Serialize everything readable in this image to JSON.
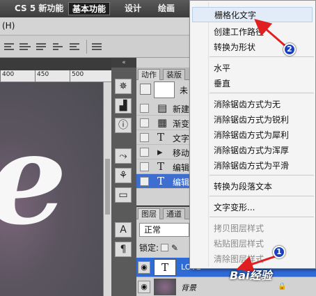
{
  "workspace": {
    "items": [
      "CS 5 新功能",
      "基本功能",
      "设计",
      "绘画"
    ],
    "active_index": 1
  },
  "menubar": {
    "partial_item": "(H)"
  },
  "ruler": {
    "labels": [
      "400",
      "450",
      "500"
    ]
  },
  "canvas": {
    "text": "e"
  },
  "panels": {
    "actions_tabs": [
      "动作",
      "装版"
    ],
    "snapshot_label": "未",
    "actions": [
      {
        "glyph": "▤",
        "label": "新建"
      },
      {
        "glyph": "▦",
        "label": "渐变"
      },
      {
        "glyph": "T",
        "label": "文字"
      },
      {
        "glyph": "▸",
        "label": "移动"
      },
      {
        "glyph": "T",
        "label": "编辑"
      },
      {
        "glyph": "T",
        "label": "编辑",
        "selected": true
      }
    ],
    "layers_tabs": [
      "图层",
      "通道"
    ],
    "blend_mode": "正常",
    "lock_label": "锁定:",
    "layers": [
      {
        "thumb": "T",
        "name": "LOVE",
        "selected": true
      },
      {
        "thumb": "",
        "name": "背景",
        "locked": true
      }
    ]
  },
  "context_menu": {
    "items": [
      {
        "label": "栅格化文字",
        "highlighted": true
      },
      {
        "label": "创建工作路径"
      },
      {
        "label": "转换为形状"
      },
      {
        "separator": true
      },
      {
        "label": "水平"
      },
      {
        "label": "垂直"
      },
      {
        "separator": true
      },
      {
        "label": "消除锯齿方式为无"
      },
      {
        "label": "消除锯齿方式为锐利"
      },
      {
        "label": "消除锯齿方式为犀利"
      },
      {
        "label": "消除锯齿方式为浑厚"
      },
      {
        "label": "消除锯齿方式为平滑"
      },
      {
        "separator": true
      },
      {
        "label": "转换为段落文本"
      },
      {
        "separator": true
      },
      {
        "label": "文字变形..."
      },
      {
        "separator": true
      },
      {
        "label": "拷贝图层样式",
        "disabled": true
      },
      {
        "label": "粘贴图层样式",
        "disabled": true
      },
      {
        "label": "清除图层样式",
        "disabled": true
      }
    ]
  },
  "annotations": {
    "badge_1": "1",
    "badge_2": "2",
    "arrow_color": "#e02020"
  },
  "watermark": "Bai经验"
}
